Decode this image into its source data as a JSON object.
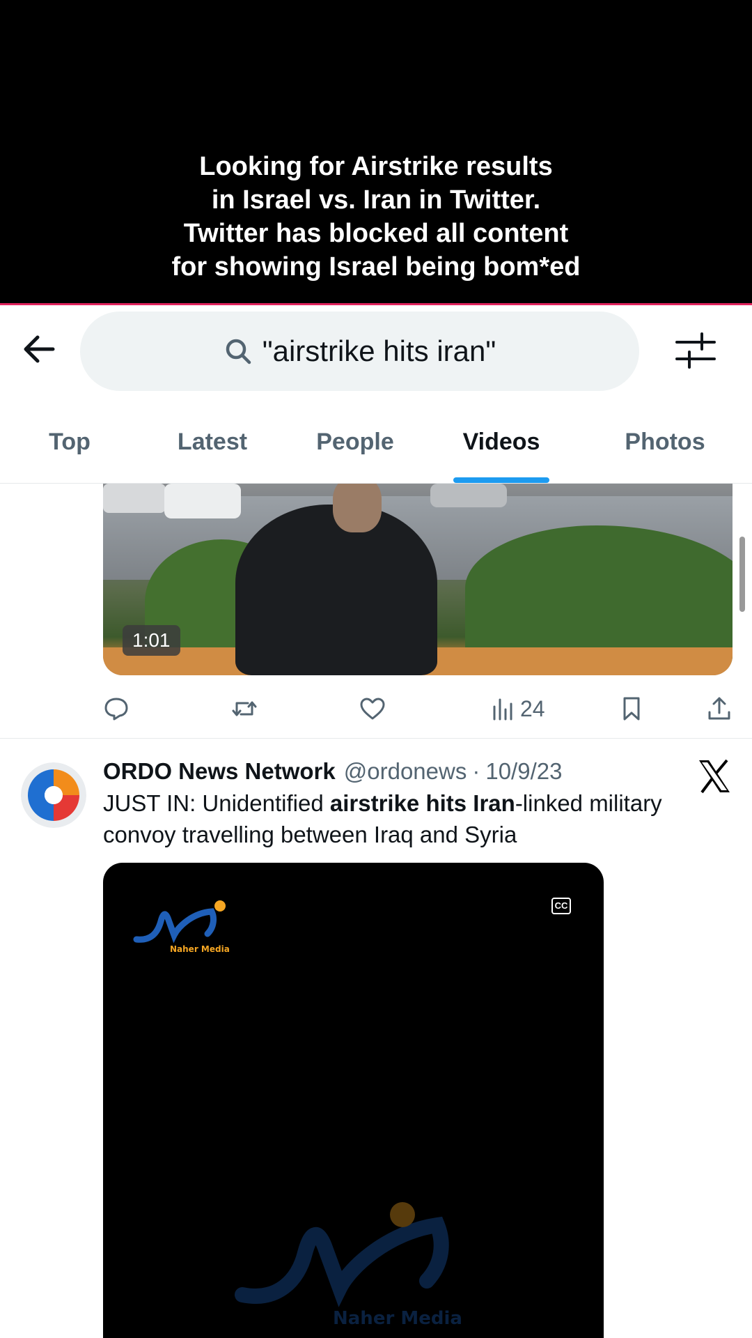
{
  "caption": {
    "lines": [
      "Looking for Airstrike results",
      "in Israel vs. Iran in Twitter.",
      "Twitter has blocked all content",
      "for showing Israel being bom*ed"
    ]
  },
  "search": {
    "query": "\"airstrike hits iran\""
  },
  "tabs": [
    {
      "label": "Top",
      "active": false
    },
    {
      "label": "Latest",
      "active": false
    },
    {
      "label": "People",
      "active": false
    },
    {
      "label": "Videos",
      "active": true
    },
    {
      "label": "Photos",
      "active": false
    }
  ],
  "first_video": {
    "duration": "1:01",
    "views": "24"
  },
  "tweet": {
    "name": "ORDO News Network",
    "handle": "@ordonews",
    "separator": "·",
    "date": "10/9/23",
    "text_before": "JUST IN: Unidentified ",
    "text_bold": "airstrike hits Iran",
    "text_after": "-linked military convoy travelling between Iraq and Syria"
  },
  "video2": {
    "cc_label": "CC",
    "logo_text": "Naher Media"
  },
  "colors": {
    "accent": "#1d9bf0",
    "caption_border": "#e0245e",
    "muted": "#536471"
  }
}
